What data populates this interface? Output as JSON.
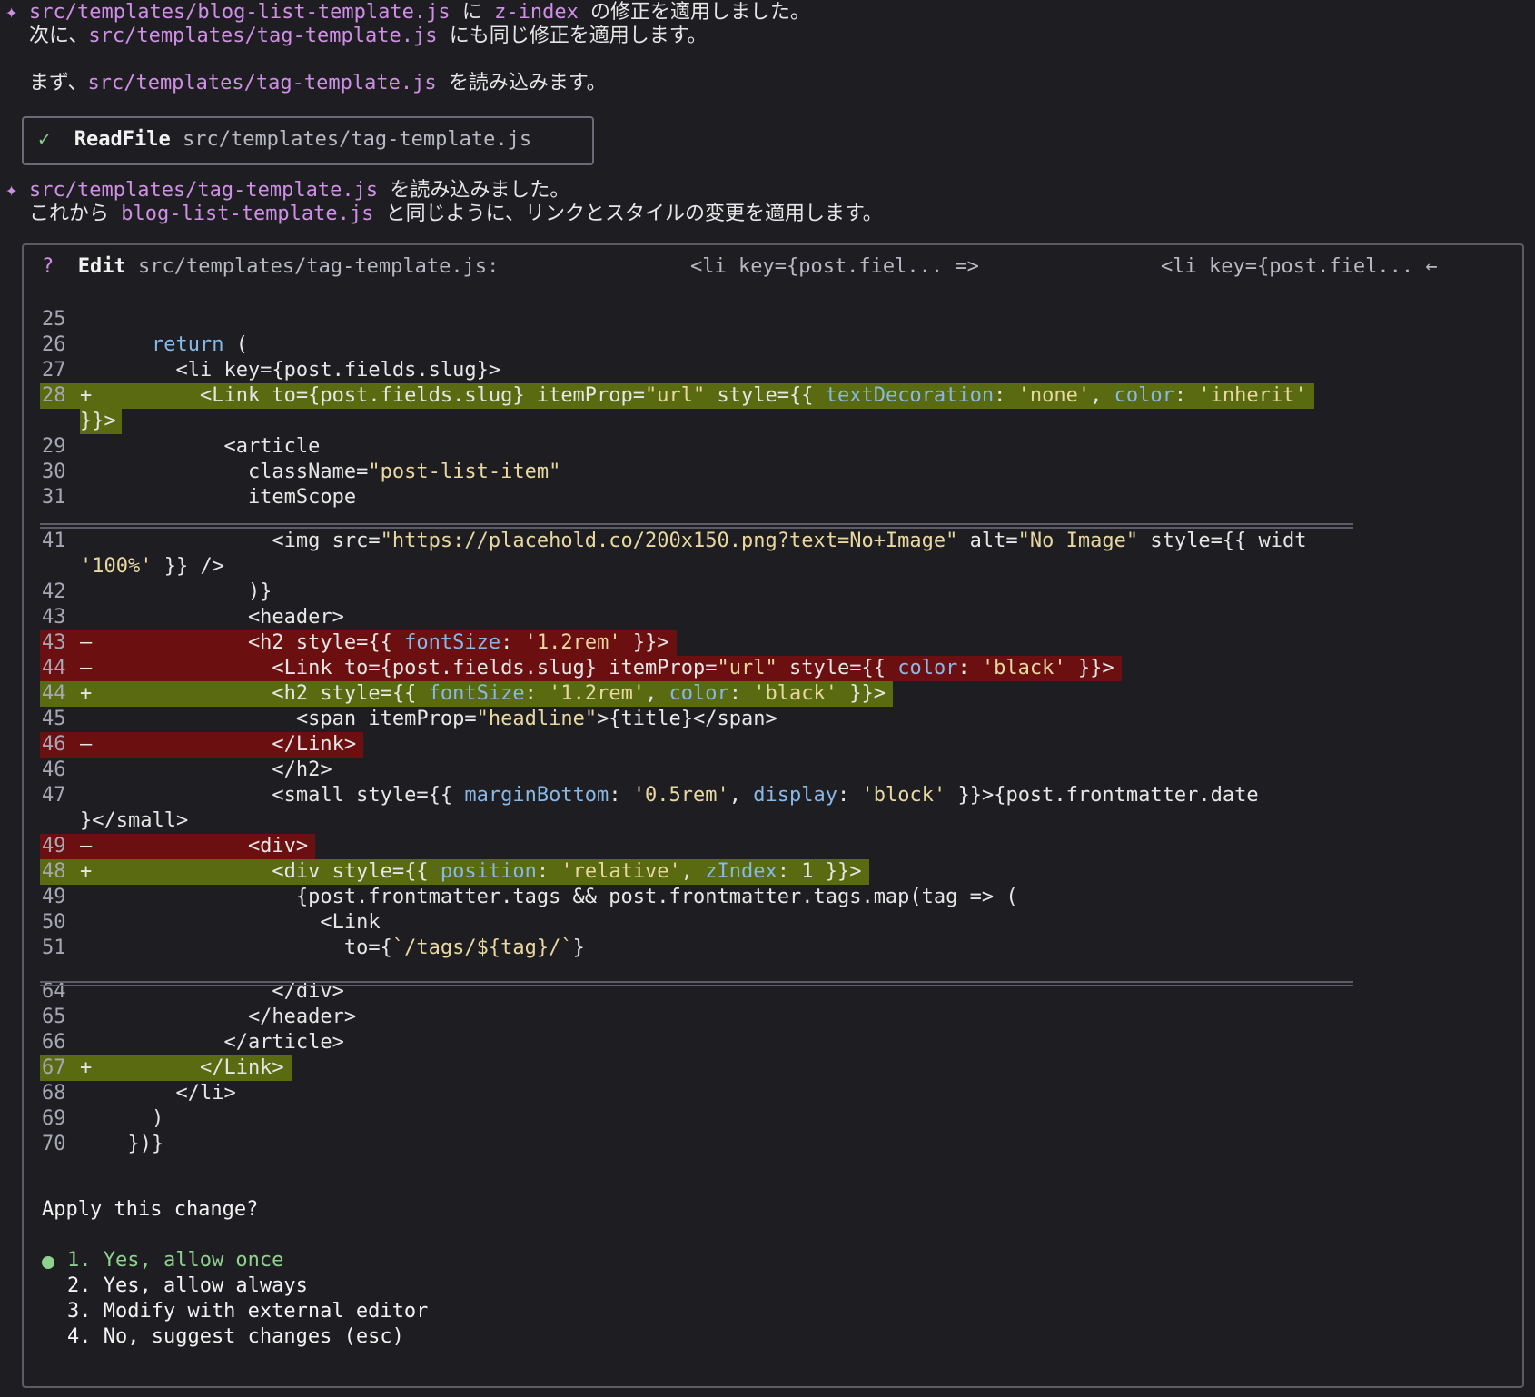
{
  "transcript": {
    "line1_path": "src/templates/blog-list-template.js",
    "line1_mid": " に ",
    "line1_token": "z-index",
    "line1_tail": " の修正を適用しました。",
    "line2_head": "次に、",
    "line2_path": "src/templates/tag-template.js",
    "line2_tail": " にも同じ修正を適用します。",
    "line3_head": "まず、",
    "line3_path": "src/templates/tag-template.js",
    "line3_tail": " を読み込みます。",
    "readfile_tool": "ReadFile",
    "readfile_path": "src/templates/tag-template.js",
    "line4_path": "src/templates/tag-template.js",
    "line4_tail": " を読み込みました。",
    "line5_head": "これから ",
    "line5_path": "blog-list-template.js",
    "line5_tail": " と同じように、リンクとスタイルの変更を適用します。"
  },
  "edit": {
    "status_icon": "?",
    "tool": "Edit",
    "file": "src/templates/tag-template.js:",
    "old_preview": "<li key={post.fiel... =>",
    "new_preview": "<li key={post.fiel... ←"
  },
  "diff": [
    {
      "n": "25",
      "m": "",
      "t": ""
    },
    {
      "n": "26",
      "m": "",
      "t": "    return ("
    },
    {
      "n": "27",
      "m": "",
      "t": "      <li key={post.fields.slug}>"
    },
    {
      "n": "28",
      "m": "+",
      "t": "        <Link to={post.fields.slug} itemProp=\"url\" style={{ textDecoration: 'none', color: 'inherit'"
    },
    {
      "n": "",
      "m": "",
      "t": "}}>"
    },
    {
      "n": "29",
      "m": "",
      "t": "          <article"
    },
    {
      "n": "30",
      "m": "",
      "t": "            className=\"post-list-item\""
    },
    {
      "n": "31",
      "m": "",
      "t": "            itemScope"
    },
    {
      "n": "41",
      "m": "",
      "t": "              <img src=\"https://placehold.co/200x150.png?text=No+Image\" alt=\"No Image\" style={{ widt"
    },
    {
      "n": "",
      "m": "",
      "t": "'100%' }} />"
    },
    {
      "n": "42",
      "m": "",
      "t": "            )}"
    },
    {
      "n": "43",
      "m": "",
      "t": "            <header>"
    },
    {
      "n": "43",
      "m": "-",
      "t": "            <h2 style={{ fontSize: '1.2rem' }}>"
    },
    {
      "n": "44",
      "m": "-",
      "t": "              <Link to={post.fields.slug} itemProp=\"url\" style={{ color: 'black' }}>"
    },
    {
      "n": "44",
      "m": "+",
      "t": "              <h2 style={{ fontSize: '1.2rem', color: 'black' }}>"
    },
    {
      "n": "45",
      "m": "",
      "t": "                <span itemProp=\"headline\">{title}</span>"
    },
    {
      "n": "46",
      "m": "-",
      "t": "              </Link>"
    },
    {
      "n": "46",
      "m": "",
      "t": "              </h2>"
    },
    {
      "n": "47",
      "m": "",
      "t": "              <small style={{ marginBottom: '0.5rem', display: 'block' }}>{post.frontmatter.date"
    },
    {
      "n": "",
      "m": "",
      "t": "}</small>"
    },
    {
      "n": "49",
      "m": "-",
      "t": "            <div>"
    },
    {
      "n": "48",
      "m": "+",
      "t": "              <div style={{ position: 'relative', zIndex: 1 }}>"
    },
    {
      "n": "49",
      "m": "",
      "t": "                {post.frontmatter.tags && post.frontmatter.tags.map(tag => ("
    },
    {
      "n": "50",
      "m": "",
      "t": "                  <Link"
    },
    {
      "n": "51",
      "m": "",
      "t": "                    to={`/tags/${tag}/`}"
    },
    {
      "n": "64",
      "m": "",
      "t": "              </div>"
    },
    {
      "n": "65",
      "m": "",
      "t": "            </header>"
    },
    {
      "n": "66",
      "m": "",
      "t": "          </article>"
    },
    {
      "n": "67",
      "m": "+",
      "t": "        </Link>"
    },
    {
      "n": "68",
      "m": "",
      "t": "      </li>"
    },
    {
      "n": "69",
      "m": "",
      "t": "    )"
    },
    {
      "n": "70",
      "m": "",
      "t": "  })}"
    }
  ],
  "prompt": "Apply this change?",
  "options": [
    "1. Yes, allow once",
    "2. Yes, allow always",
    "3. Modify with external editor",
    "4. No, suggest changes (esc)"
  ],
  "colors": {
    "background": "#1e1e22",
    "added_bg": "#5a6a10",
    "removed_bg": "#6b0f10",
    "accent": "#d08fe6",
    "selected": "#8fd08f"
  }
}
